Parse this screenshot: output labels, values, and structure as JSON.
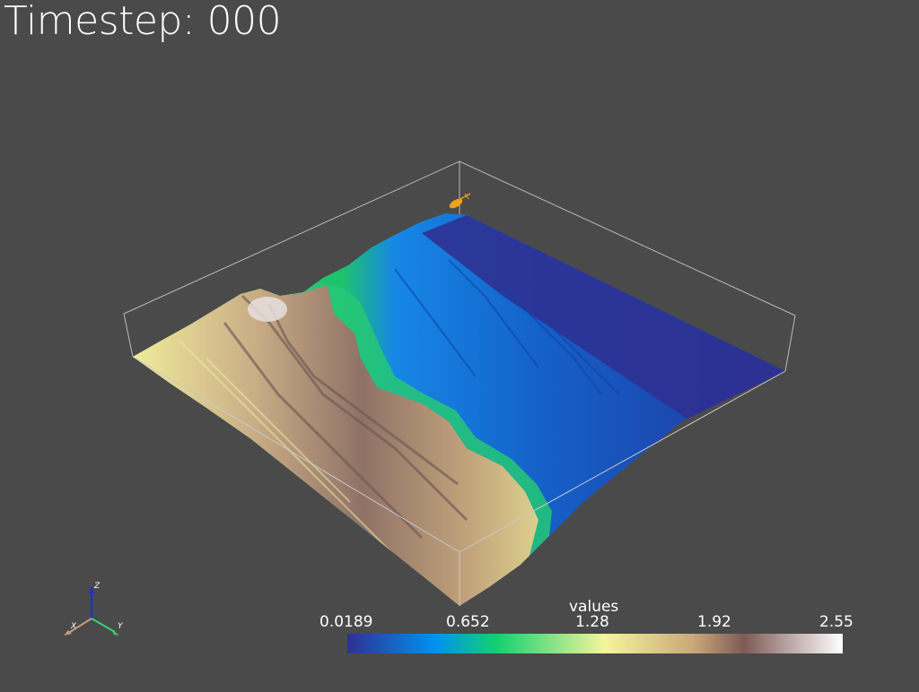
{
  "title": "Timestep: 000",
  "colorbar": {
    "title": "values",
    "ticks": [
      "0.0189",
      "0.652",
      "1.28",
      "1.92",
      "2.55"
    ],
    "stops": [
      "#2e3192",
      "#0093f0",
      "#12d070",
      "#f4f59a",
      "#c9a779",
      "#7e5a55",
      "#ffffff"
    ]
  },
  "axes": {
    "x": "X",
    "y": "Y",
    "z": "Z"
  },
  "colors": {
    "background": "#4a4a4a",
    "marker": "#f2a11d",
    "bounding_box": "#b8b8b8"
  }
}
